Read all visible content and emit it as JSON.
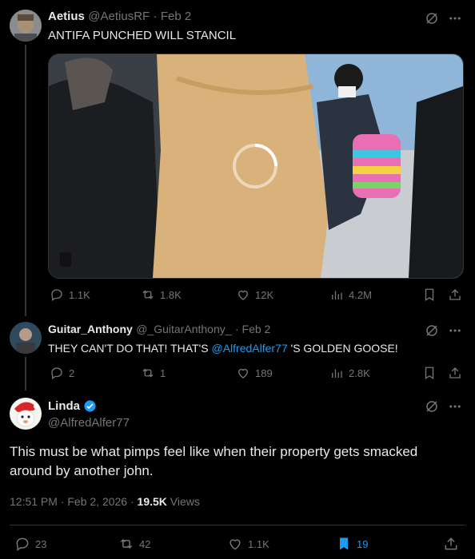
{
  "tweets": [
    {
      "name": "Aetius",
      "handle": "@AetiusRF",
      "date": "· Feb 2",
      "text": "ANTIFA PUNCHED WILL STANCIL",
      "stats": {
        "replies": "1.1K",
        "reposts": "1.8K",
        "likes": "12K",
        "views": "4.2M"
      }
    },
    {
      "name": "Guitar_Anthony",
      "handle": "@_GuitarAnthony_",
      "date": "· Feb 2",
      "text_before": "THEY CAN'T DO THAT! THAT'S ",
      "mention": "@AlfredAlfer77",
      "text_after": " 'S GOLDEN GOOSE!",
      "stats": {
        "replies": "2",
        "reposts": "1",
        "likes": "189",
        "views": "2.8K"
      }
    }
  ],
  "main": {
    "name": "Linda",
    "handle": "@AlfredAlfer77",
    "text": "This must be what pimps feel like when their property gets smacked around by another john.",
    "timestamp": "12:51 PM · Feb 2, 2026 · ",
    "views_count": "19.5K",
    "views_label": " Views",
    "stats": {
      "replies": "23",
      "reposts": "42",
      "likes": "1.1K",
      "bookmarks": "19"
    }
  },
  "colors": {
    "accent": "#1d9bf0",
    "muted": "#71767b",
    "bg": "#000000"
  },
  "icons": [
    "grok-icon",
    "more-icon",
    "reply-icon",
    "repost-icon",
    "like-icon",
    "views-icon",
    "bookmark-icon",
    "share-icon",
    "verified-icon"
  ]
}
